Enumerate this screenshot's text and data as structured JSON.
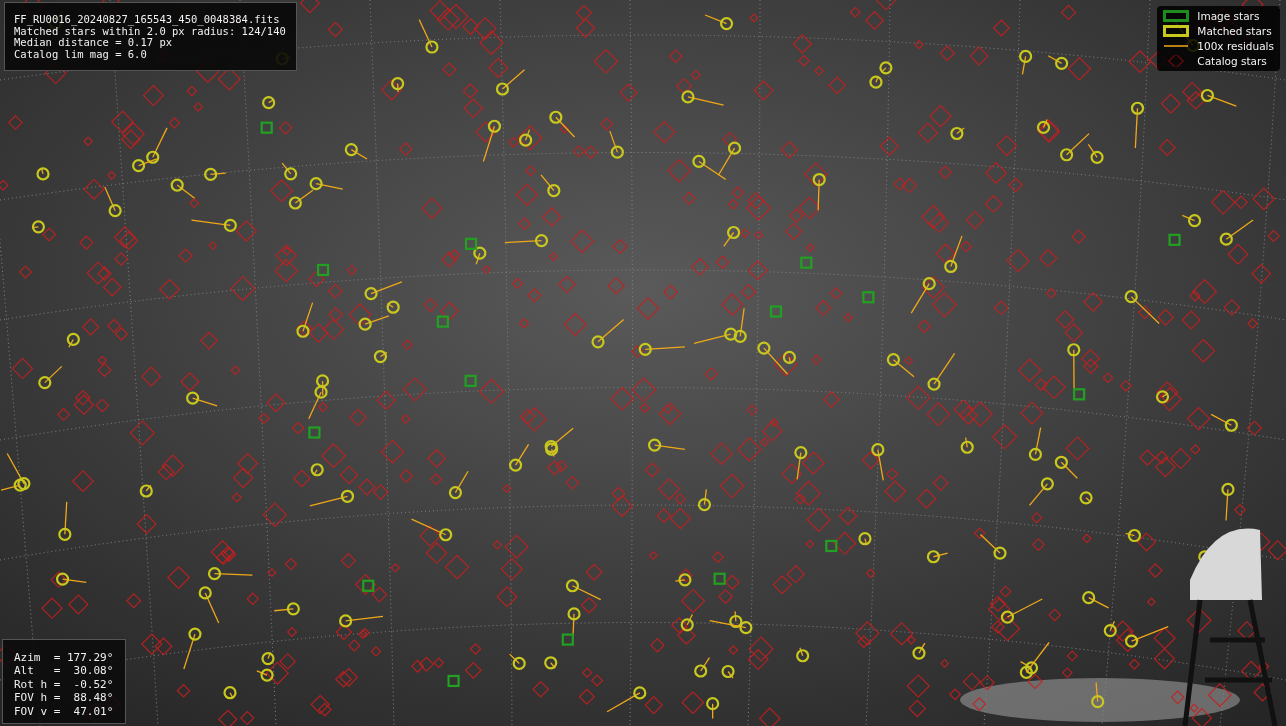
{
  "image": {
    "info_lines": [
      "FF_RU0016_20240827_165543_450_0048384.fits",
      "Matched stars within 2.0 px radius: 124/140",
      "Median distance = 0.17 px",
      "Catalog lim mag = 6.0"
    ],
    "legend": [
      {
        "kind": "image",
        "label": "Image stars"
      },
      {
        "kind": "matched",
        "label": "Matched stars"
      },
      {
        "kind": "residual",
        "label": "100x residuals"
      },
      {
        "kind": "catalog",
        "label": "Catalog stars"
      }
    ],
    "pointing_lines": [
      "Azim  = 177.29°",
      "Alt   =  30.08°",
      "Rot h =  -0.52°",
      "FOV h =  88.48°",
      "FOV v =  47.01°"
    ]
  }
}
